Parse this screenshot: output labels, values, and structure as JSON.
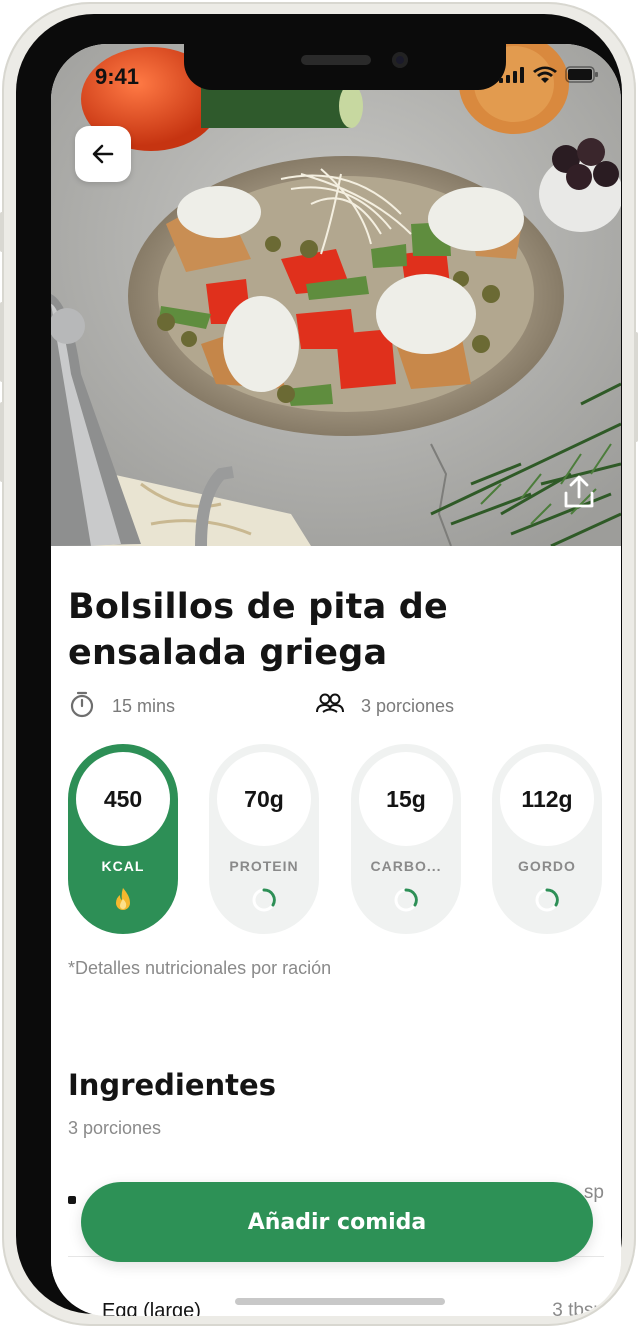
{
  "status_bar": {
    "time": "9:41"
  },
  "hero": {
    "image_alt": ""
  },
  "recipe": {
    "title": "Bolsillos de pita de ensalada griega",
    "time": "15 mins",
    "servings": "3 porciones"
  },
  "nutrition": [
    {
      "value": "450",
      "label": "KCAL",
      "active": true
    },
    {
      "value": "70g",
      "label": "PROTEIN",
      "active": false
    },
    {
      "value": "15g",
      "label": "CARBO...",
      "active": false
    },
    {
      "value": "112g",
      "label": "GORDO",
      "active": false
    }
  ],
  "nutrition_note": "*Detalles nutricionales por ración",
  "ingredients": {
    "title": "Ingredientes",
    "servings": "3 porciones",
    "items": [
      {
        "name": "",
        "qty": "sp"
      },
      {
        "name": "Egg (large)",
        "qty": "3 tbsp"
      }
    ]
  },
  "cta": {
    "label": "Añadir comida"
  },
  "colors": {
    "accent": "#2d8f56",
    "pill_bg": "#f0f2f1"
  },
  "icons": [
    "back-arrow-icon",
    "share-icon",
    "timer-icon",
    "people-icon",
    "flame-icon",
    "signal-icon",
    "wifi-icon",
    "battery-icon"
  ]
}
